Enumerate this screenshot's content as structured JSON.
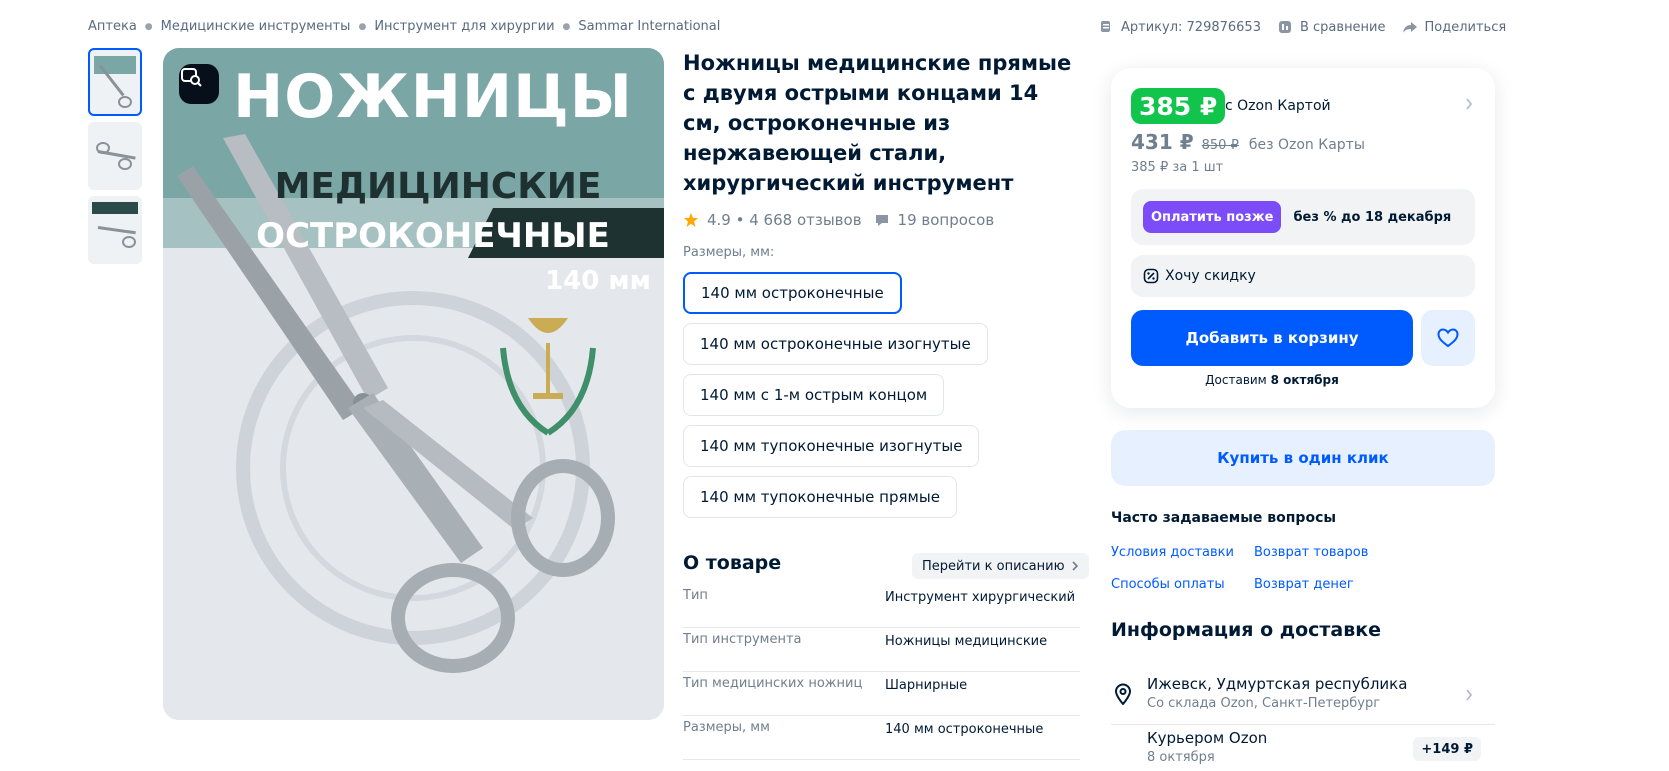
{
  "breadcrumbs": [
    "Аптека",
    "Медицинские инструменты",
    "Инструмент для хирургии",
    "Sammar International"
  ],
  "top_actions": {
    "article": "Артикул: 729876653",
    "compare": "В сравнение",
    "share": "Поделиться"
  },
  "product_image": {
    "line1": "НОЖНИЦЫ",
    "line2": "МЕДИЦИНСКИЕ",
    "line3": "ОСТРОКОНЕЧНЫЕ",
    "size": "140 мм"
  },
  "product": {
    "title": "Ножницы медицинские прямые с двумя острыми концами 14 см, остроконечные из нержавеющей стали, хирургический инструмент",
    "rating": "4.9 • 4 668 отзывов",
    "questions": "19 вопросов"
  },
  "sizes": {
    "label": "Размеры, мм:",
    "options": [
      "140 мм остроконечные",
      "140 мм остроконечные изогнутые",
      "140 мм с 1-м острым концом",
      "140 мм тупоконечные изогнутые",
      "140 мм тупоконечные прямые"
    ]
  },
  "about": {
    "heading": "О товаре",
    "link": "Перейти к описанию",
    "specs": [
      {
        "key": "Тип",
        "value": "Инструмент хирургический"
      },
      {
        "key": "Тип инструмента",
        "value": "Ножницы медицинские"
      },
      {
        "key": "Тип медицинских ножниц",
        "value": "Шарнирные"
      },
      {
        "key": "Размеры, мм",
        "value": "140 мм остроконечные"
      }
    ]
  },
  "price": {
    "card_price": "385 ₽",
    "card_note": "с Ozon Картой",
    "price": "431 ₽",
    "old_price": "850 ₽",
    "no_card_note": "без Ozon Карты",
    "per_unit": "385 ₽ за 1 шт",
    "pay_later_button": "Оплатить позже",
    "pay_later_text": "без % до 18 декабря",
    "want_discount": "Хочу скидку",
    "add_to_cart": "Добавить в корзину",
    "deliver_prefix": "Доставим",
    "deliver_date": "8 октября"
  },
  "one_click": "Купить в один клик",
  "faq": {
    "heading": "Часто задаваемые вопросы",
    "links": [
      "Условия доставки",
      "Возврат товаров",
      "Способы оплаты",
      "Возврат денег"
    ]
  },
  "delivery": {
    "heading": "Информация о доставке",
    "city": "Ижевск, Удмуртская республика",
    "warehouse": "Со склада Ozon, Санкт-Петербург",
    "courier": "Курьером Ozon",
    "courier_date": "8 октября",
    "courier_price": "+149 ₽"
  },
  "colors": {
    "accent": "#005bff",
    "price_green": "#10c44c",
    "pay_later": "#7b4cf7"
  }
}
